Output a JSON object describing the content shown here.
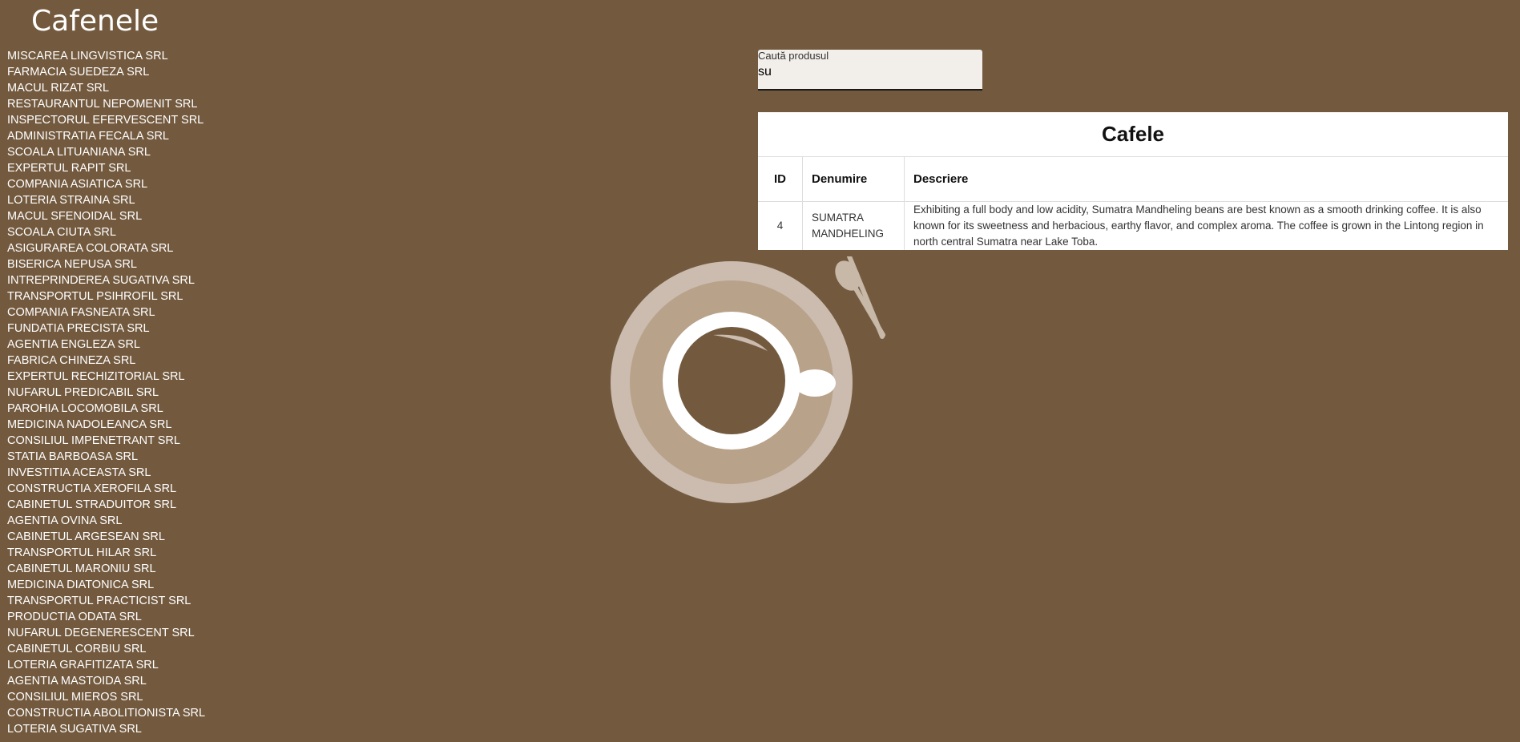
{
  "page": {
    "title": "Cafenele"
  },
  "companies": [
    "MISCAREA LINGVISTICA SRL",
    "FARMACIA SUEDEZA SRL",
    "MACUL RIZAT SRL",
    "RESTAURANTUL NEPOMENIT SRL",
    "INSPECTORUL EFERVESCENT SRL",
    "ADMINISTRATIA FECALA SRL",
    "SCOALA LITUANIANA SRL",
    "EXPERTUL RAPIT SRL",
    "COMPANIA ASIATICA SRL",
    "LOTERIA STRAINA SRL",
    "MACUL SFENOIDAL SRL",
    "SCOALA CIUTA SRL",
    "ASIGURAREA COLORATA SRL",
    "BISERICA NEPUSA SRL",
    "INTREPRINDEREA SUGATIVA SRL",
    "TRANSPORTUL PSIHROFIL SRL",
    "COMPANIA FASNEATA SRL",
    "FUNDATIA PRECISTA SRL",
    "AGENTIA ENGLEZA SRL",
    "FABRICA CHINEZA SRL",
    "EXPERTUL RECHIZITORIAL SRL",
    "NUFARUL PREDICABIL SRL",
    "PAROHIA LOCOMOBILA SRL",
    "MEDICINA NADOLEANCA SRL",
    "CONSILIUL IMPENETRANT SRL",
    "STATIA BARBOASA SRL",
    "INVESTITIA ACEASTA SRL",
    "CONSTRUCTIA XEROFILA SRL",
    "CABINETUL STRADUITOR SRL",
    "AGENTIA OVINA SRL",
    "CABINETUL ARGESEAN SRL",
    "TRANSPORTUL HILAR SRL",
    "CABINETUL MARONIU SRL",
    "MEDICINA DIATONICA SRL",
    "TRANSPORTUL PRACTICIST SRL",
    "PRODUCTIA ODATA SRL",
    "NUFARUL DEGENERESCENT SRL",
    "CABINETUL CORBIU SRL",
    "LOTERIA GRAFITIZATA SRL",
    "AGENTIA MASTOIDA SRL",
    "CONSILIUL MIEROS SRL",
    "CONSTRUCTIA ABOLITIONISTA SRL",
    "LOTERIA SUGATIVA SRL"
  ],
  "search": {
    "label": "Caută produsul",
    "value": "su"
  },
  "table": {
    "title": "Cafele",
    "headers": {
      "id": "ID",
      "name": "Denumire",
      "description": "Descriere"
    },
    "rows": [
      {
        "id": "4",
        "name": "SUMATRA MANDHELING",
        "description": "Exhibiting a full body and low acidity, Sumatra Mandheling beans are best known as a smooth drinking coffee. It is also known for its sweetness and herbacious, earthy flavor, and complex aroma. The coffee is grown in the Lintong region in north central Sumatra near Lake Toba."
      }
    ]
  },
  "colors": {
    "background": "#735a3f",
    "saucer_outer": "#cbbcaf",
    "saucer_inner": "#b9a28a",
    "cup": "#ffffff",
    "coffee": "#735a3f",
    "spoon": "#c8b8a8"
  },
  "icons": {
    "logo": "coffee-cup-icon"
  }
}
